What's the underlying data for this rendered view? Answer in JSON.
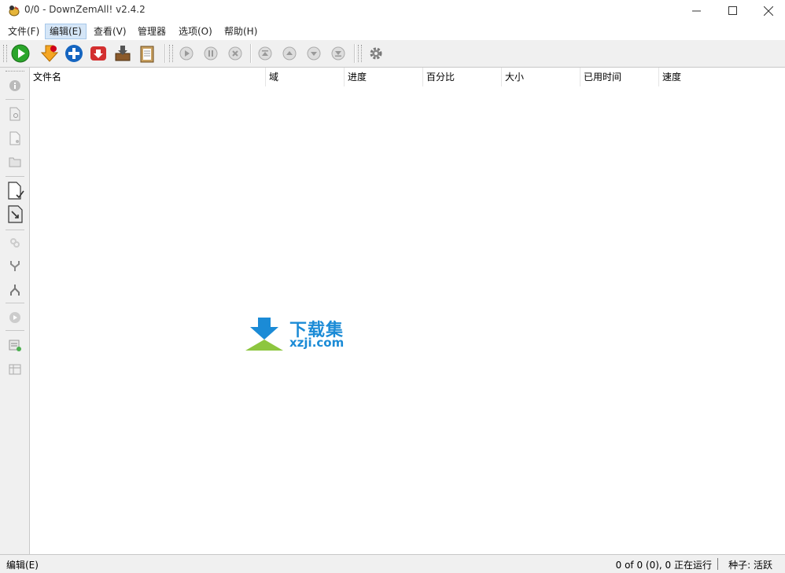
{
  "window": {
    "title": "0/0 - DownZemAll! v2.4.2",
    "icon": "downzemall-app-icon"
  },
  "menu": [
    {
      "label": "文件(F)"
    },
    {
      "label": "编辑(E)"
    },
    {
      "label": "查看(V)"
    },
    {
      "label": "管理器"
    },
    {
      "label": "选项(O)"
    },
    {
      "label": "帮助(H)"
    }
  ],
  "toolbar_icons": [
    "start-green-play-icon",
    "download-orange-arrow-icon",
    "add-blue-plus-icon",
    "remove-red-down-icon",
    "download-manager-icon",
    "clipboard-paste-icon",
    "resume-icon",
    "pause-icon",
    "cancel-icon",
    "move-top-icon",
    "move-up-icon",
    "move-down-icon",
    "move-bottom-icon",
    "settings-gear-icon"
  ],
  "table": {
    "columns": [
      {
        "label": "文件名"
      },
      {
        "label": "域"
      },
      {
        "label": "进度"
      },
      {
        "label": "百分比"
      },
      {
        "label": "大小"
      },
      {
        "label": "已用时间"
      },
      {
        "label": "速度"
      }
    ],
    "rows": []
  },
  "watermark": {
    "text_cn": "下载集",
    "text_en": "xzji.com"
  },
  "status": {
    "left": "编辑(E)",
    "running": "0 of 0 (0), 0 正在运行",
    "seeds": "种子: 活跃"
  },
  "colors": {
    "menu_active_bg": "#d5e6f7",
    "toolbar_bg": "#f0f0f0",
    "watermark_blue": "#1b8bd6",
    "watermark_green": "#8dc63f"
  }
}
